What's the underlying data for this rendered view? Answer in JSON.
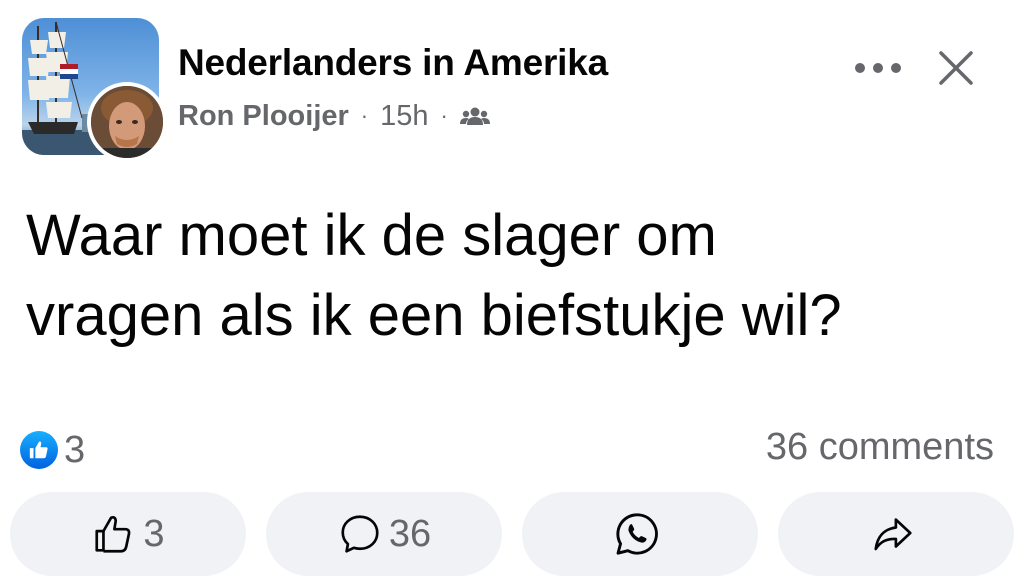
{
  "header": {
    "group_name": "Nederlanders in Amerika",
    "author": "Ron Plooijer",
    "timestamp": "15h",
    "separator": "·",
    "audience_icon": "group-members-icon",
    "more_icon": "more-options-icon",
    "close_icon": "close-icon"
  },
  "post": {
    "text": "Waar moet ik de slager om\nvragen als ik een biefstukje wil?"
  },
  "stats": {
    "reaction_icon": "like-reaction-icon",
    "reaction_count": "3",
    "comments": "36 comments"
  },
  "actions": {
    "like_count": "3",
    "comment_count": "36",
    "like_icon": "thumbs-up-icon",
    "comment_icon": "comment-bubble-icon",
    "whatsapp_icon": "whatsapp-icon",
    "share_icon": "share-arrow-icon"
  },
  "colors": {
    "like_blue": "#0866ff",
    "secondary_text": "#65676b",
    "button_bg": "#f0f2f5"
  }
}
